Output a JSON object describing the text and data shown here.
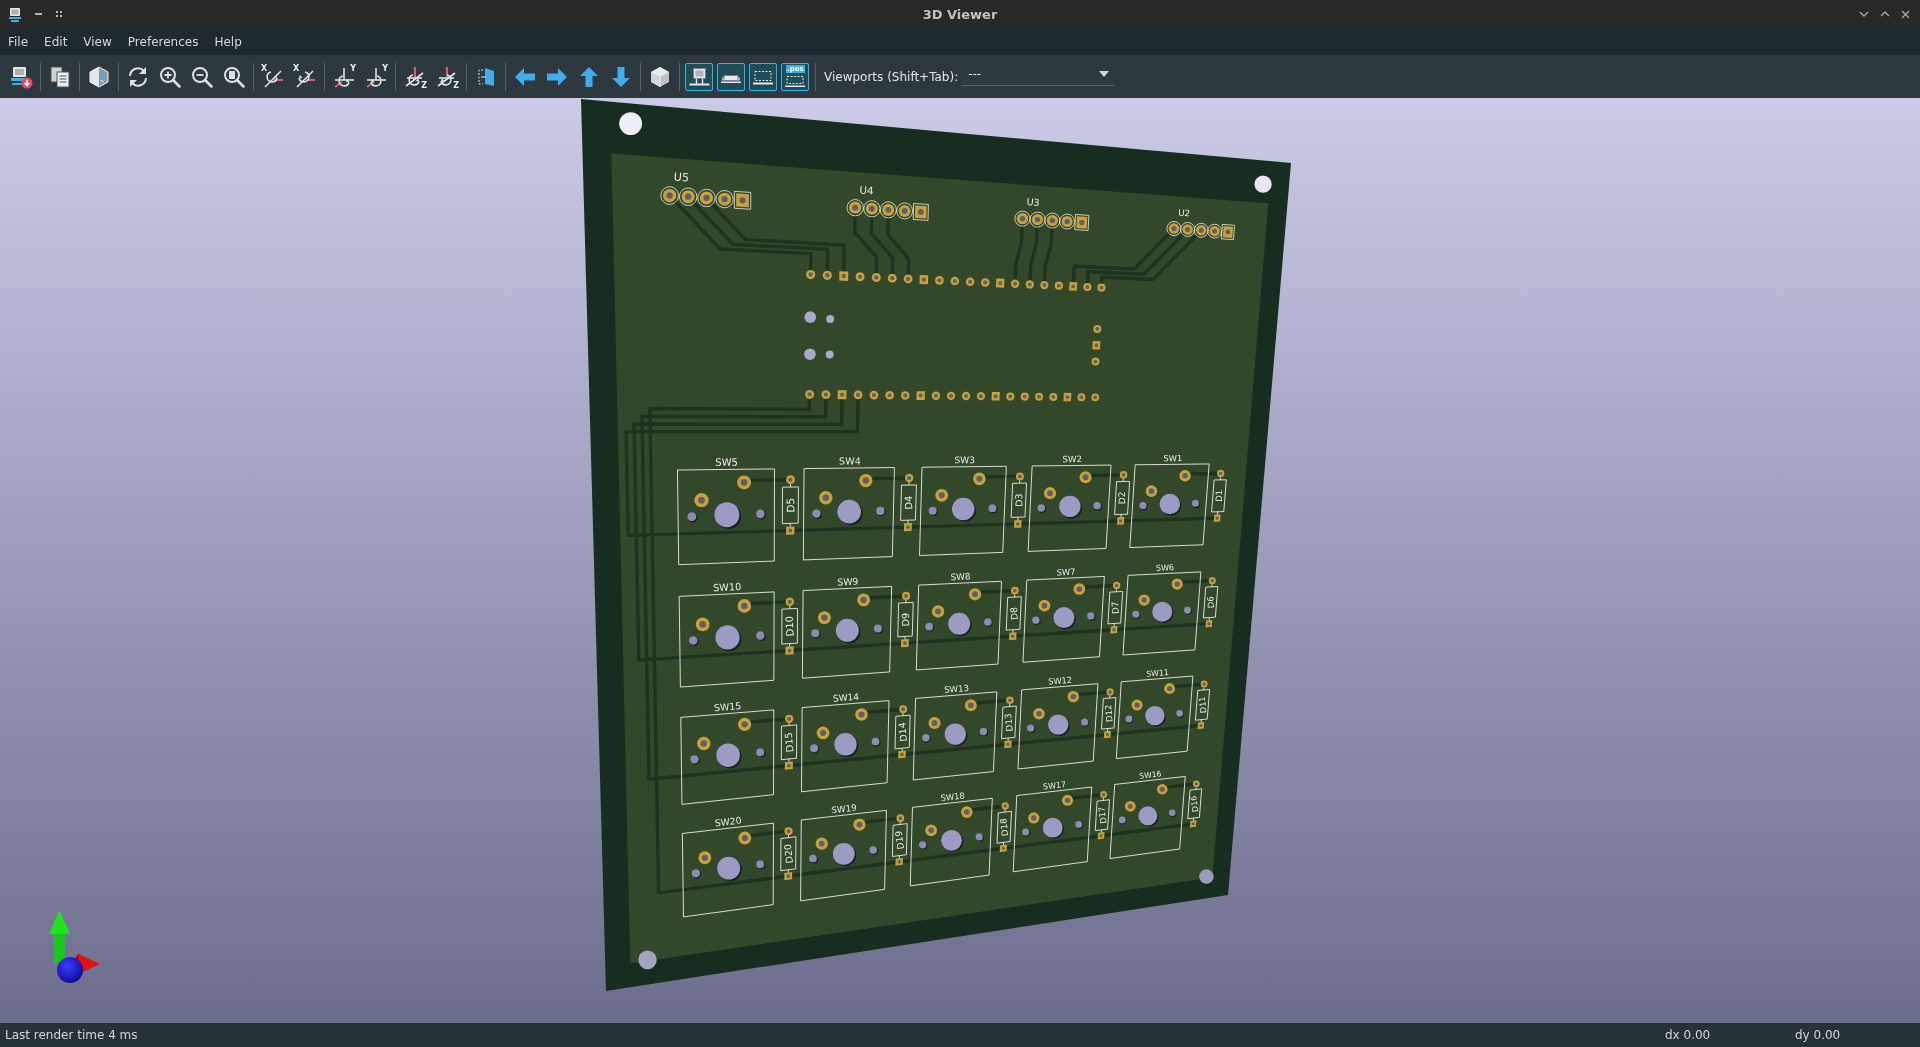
{
  "window": {
    "title": "3D Viewer"
  },
  "menu": [
    {
      "label": "File"
    },
    {
      "label": "Edit"
    },
    {
      "label": "View"
    },
    {
      "label": "Preferences"
    },
    {
      "label": "Help"
    }
  ],
  "toolbar": {
    "groups": [
      [
        {
          "kind": "export"
        }
      ],
      [
        {
          "kind": "copy"
        }
      ],
      [
        {
          "kind": "render-options"
        }
      ],
      [
        {
          "kind": "reload"
        },
        {
          "kind": "zoom-in"
        },
        {
          "kind": "zoom-out"
        },
        {
          "kind": "zoom-fit"
        }
      ],
      [
        {
          "kind": "rotate-x-cw",
          "axis_label": "X"
        },
        {
          "kind": "rotate-x-ccw",
          "axis_label": "X"
        }
      ],
      [
        {
          "kind": "rotate-y-cw",
          "axis_label": "Y"
        },
        {
          "kind": "rotate-y-ccw",
          "axis_label": "Y"
        }
      ],
      [
        {
          "kind": "rotate-z-cw",
          "axis_label": "Z"
        },
        {
          "kind": "rotate-z-ccw",
          "axis_label": "Z"
        }
      ],
      [
        {
          "kind": "flip"
        }
      ],
      [
        {
          "kind": "move-left"
        },
        {
          "kind": "move-right"
        },
        {
          "kind": "move-up"
        },
        {
          "kind": "move-down"
        }
      ],
      [
        {
          "kind": "cube"
        }
      ],
      [
        {
          "kind": "toggle-tht",
          "on": true
        },
        {
          "kind": "toggle-smd",
          "on": true
        },
        {
          "kind": "toggle-virtual",
          "on": true
        },
        {
          "kind": "toggle-pos",
          "on": true,
          "badge": ".pos"
        }
      ]
    ],
    "viewports": {
      "label": "Viewports (Shift+Tab):",
      "value": "---"
    }
  },
  "board": {
    "headers": [
      {
        "label": "U5"
      },
      {
        "label": "U4"
      },
      {
        "label": "U3"
      },
      {
        "label": "U2"
      }
    ],
    "switch_rows": [
      [
        {
          "label": "SW5",
          "diode": "D5"
        },
        {
          "label": "SW4",
          "diode": "D4"
        },
        {
          "label": "SW3",
          "diode": "D3"
        },
        {
          "label": "SW2",
          "diode": "D2"
        },
        {
          "label": "SW1",
          "diode": "D1"
        }
      ],
      [
        {
          "label": "SW10",
          "diode": "D10"
        },
        {
          "label": "SW9",
          "diode": "D9"
        },
        {
          "label": "SW8",
          "diode": "D8"
        },
        {
          "label": "SW7",
          "diode": "D7"
        },
        {
          "label": "SW6",
          "diode": "D6"
        }
      ],
      [
        {
          "label": "SW15",
          "diode": "D15"
        },
        {
          "label": "SW14",
          "diode": "D14"
        },
        {
          "label": "SW13",
          "diode": "D13"
        },
        {
          "label": "SW12",
          "diode": "D12"
        },
        {
          "label": "SW11",
          "diode": "D11"
        }
      ],
      [
        {
          "label": "SW20",
          "diode": "D20"
        },
        {
          "label": "SW19",
          "diode": "D19"
        },
        {
          "label": "SW18",
          "diode": "D18"
        },
        {
          "label": "SW17",
          "diode": "D17"
        },
        {
          "label": "SW16",
          "diode": "D16"
        }
      ]
    ]
  },
  "status_bar": {
    "render_time": "Last render time 4 ms",
    "dx": "dx 0.00",
    "dy": "dy 0.00"
  }
}
